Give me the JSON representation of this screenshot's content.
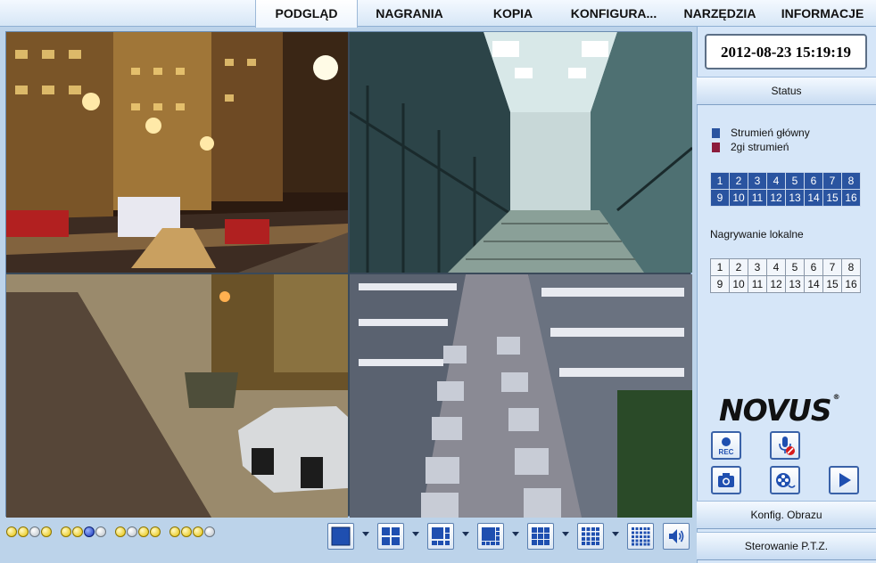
{
  "nav": {
    "tabs": [
      {
        "label": "PODGLĄD",
        "active": true
      },
      {
        "label": "NAGRANIA"
      },
      {
        "label": "KOPIA"
      },
      {
        "label": "KONFIGURA..."
      },
      {
        "label": "NARZĘDZIA"
      },
      {
        "label": "INFORMACJE"
      }
    ]
  },
  "video": {
    "channels": [
      {
        "scene": "city-street-night",
        "icon": "camera-feed-1"
      },
      {
        "scene": "staircase-corridor",
        "icon": "camera-feed-2"
      },
      {
        "scene": "sidewalk-parked-car",
        "icon": "camera-feed-3"
      },
      {
        "scene": "parking-garage-night",
        "icon": "camera-feed-4"
      }
    ]
  },
  "status_dots": [
    [
      "yellow",
      "yellow",
      "grey",
      "yellow"
    ],
    [
      "yellow",
      "yellow",
      "blue",
      "grey"
    ],
    [
      "yellow",
      "grey",
      "yellow",
      "yellow"
    ],
    [
      "yellow",
      "yellow",
      "yellow",
      "grey"
    ]
  ],
  "layout_buttons": [
    "layout-1-icon",
    "layout-4-icon",
    "layout-6-icon",
    "layout-8-icon",
    "layout-9-icon",
    "layout-16-icon",
    "layout-25-icon"
  ],
  "side": {
    "datetime": "2012-08-23 15:19:19",
    "status_label": "Status",
    "legend": [
      {
        "label": "Strumień główny",
        "color": "#2a54a0"
      },
      {
        "label": "2gi strumień",
        "color": "#8c1c3c"
      }
    ],
    "main_channels": [
      "1",
      "2",
      "3",
      "4",
      "5",
      "6",
      "7",
      "8",
      "9",
      "10",
      "11",
      "12",
      "13",
      "14",
      "15",
      "16"
    ],
    "local_label": "Nagrywanie lokalne",
    "local_channels": [
      "1",
      "2",
      "3",
      "4",
      "5",
      "6",
      "7",
      "8",
      "9",
      "10",
      "11",
      "12",
      "13",
      "14",
      "15",
      "16"
    ],
    "brand": "NOVUS",
    "rec_label": "REC",
    "image_config_label": "Konfig. Obrazu",
    "ptz_label": "Sterowanie P.T.Z."
  },
  "colors": {
    "accent": "#2a54a0",
    "secondary_stream": "#8c1c3c",
    "button_border": "#3a62a8"
  }
}
